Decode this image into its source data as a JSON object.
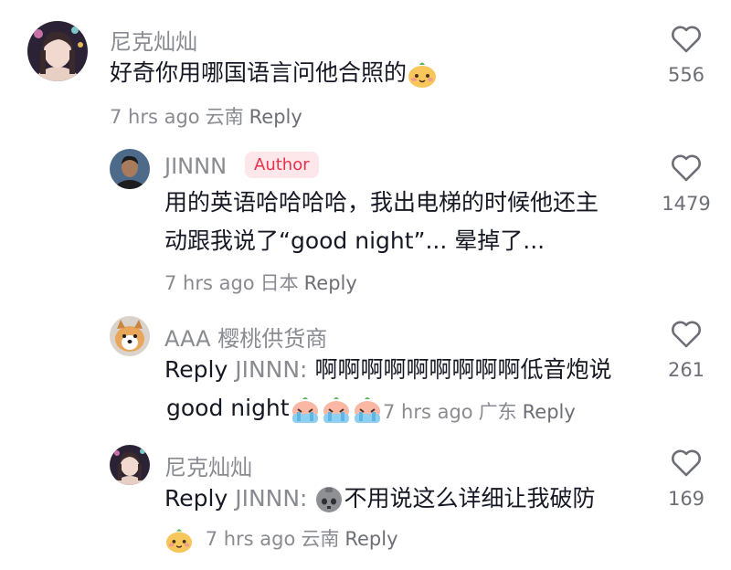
{
  "comments": [
    {
      "name": "尼克灿灿",
      "text": "好奇你用哪国语言问他合照的",
      "time": "7 hrs ago",
      "location": "云南",
      "reply": "Reply",
      "likes": "556"
    },
    {
      "name": "JINNN",
      "badge": "Author",
      "line1": "用的英语哈哈哈哈，我出电梯的时候他还主",
      "line2": "动跟我说了“good night”... 晕掉了...",
      "time": "7 hrs ago",
      "location": "日本",
      "reply": "Reply",
      "likes": "1479"
    },
    {
      "name": "AAA 樱桃供货商",
      "reply_prefix": "Reply",
      "mention": "JINNN:",
      "line1": "啊啊啊啊啊啊啊啊啊低音炮说",
      "line2": "good night",
      "time": "7 hrs ago",
      "location": "广东",
      "reply": "Reply",
      "likes": "261"
    },
    {
      "name": "尼克灿灿",
      "reply_prefix": "Reply",
      "mention": "JINNN:",
      "text": "不用说这么详细让我破防",
      "time": "7 hrs ago",
      "location": "云南",
      "reply": "Reply",
      "likes": "169"
    }
  ],
  "colors": {
    "secondary_text": "#8a8b91",
    "author_badge_bg": "#fde7ea",
    "author_badge_text": "#e8324c"
  },
  "icons": [
    "heart-outline-icon",
    "smiling-bun-emoji",
    "crying-bun-emoji",
    "skull-emoji"
  ]
}
